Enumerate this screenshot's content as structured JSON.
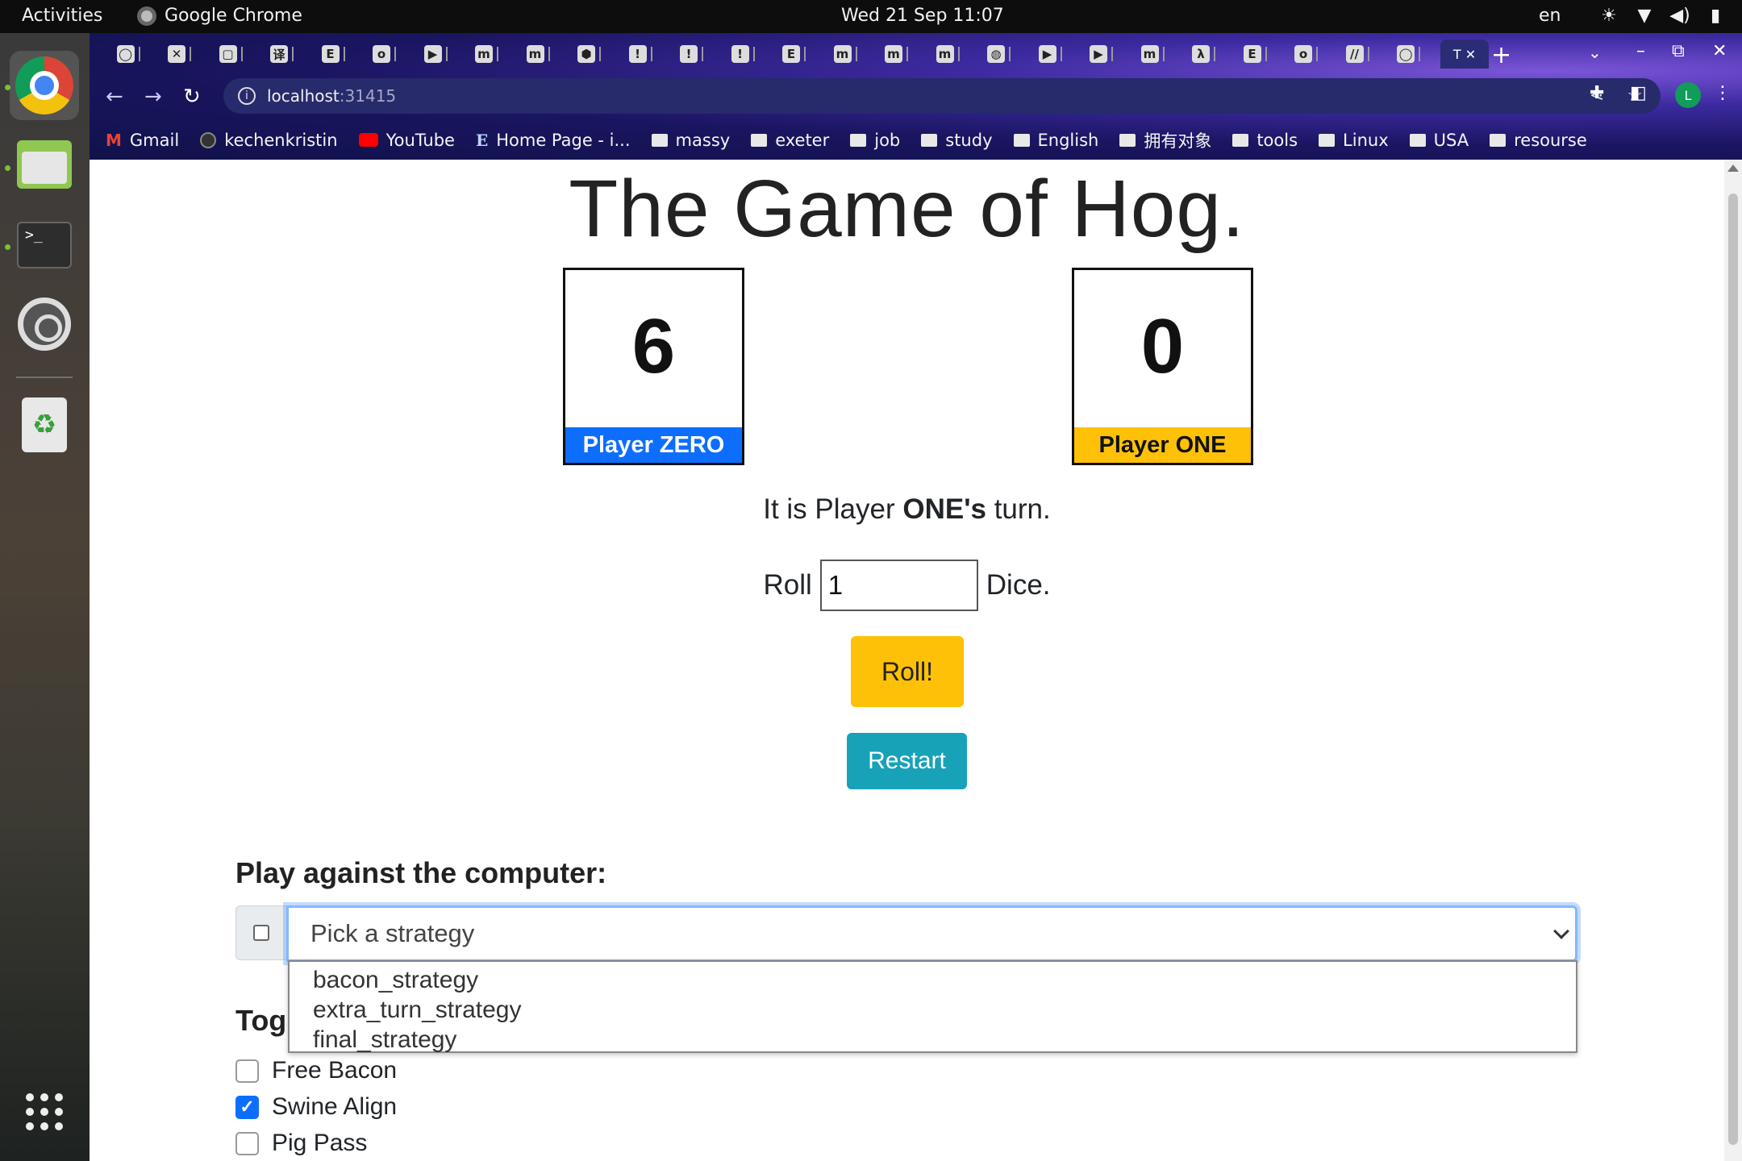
{
  "os": {
    "activities": "Activities",
    "app_name": "Google Chrome",
    "clock": "Wed 21 Sep  11:07",
    "language": "en"
  },
  "browser": {
    "tabs": [
      {
        "icon": "github-icon",
        "glyph": "◯"
      },
      {
        "icon": "exeter-icon",
        "glyph": "✕"
      },
      {
        "icon": "blank-icon",
        "glyph": "▢"
      },
      {
        "icon": "translate-icon",
        "glyph": "译"
      },
      {
        "icon": "e-icon",
        "glyph": "E"
      },
      {
        "icon": "outlook-icon",
        "glyph": "o"
      },
      {
        "icon": "play-icon",
        "glyph": "▶"
      },
      {
        "icon": "m-icon",
        "glyph": "m"
      },
      {
        "icon": "m-icon",
        "glyph": "m"
      },
      {
        "icon": "cube-icon",
        "glyph": "⬢"
      },
      {
        "icon": "red-icon",
        "glyph": "!"
      },
      {
        "icon": "red-icon",
        "glyph": "!"
      },
      {
        "icon": "red-icon",
        "glyph": "!"
      },
      {
        "icon": "e-icon",
        "glyph": "E"
      },
      {
        "icon": "m-icon",
        "glyph": "m"
      },
      {
        "icon": "m-icon",
        "glyph": "m"
      },
      {
        "icon": "m-icon",
        "glyph": "m"
      },
      {
        "icon": "globe-icon",
        "glyph": "◍"
      },
      {
        "icon": "play-icon",
        "glyph": "▶"
      },
      {
        "icon": "play-icon",
        "glyph": "▶"
      },
      {
        "icon": "m-icon",
        "glyph": "m"
      },
      {
        "icon": "lambda-icon",
        "glyph": "λ"
      },
      {
        "icon": "e-icon",
        "glyph": "E"
      },
      {
        "icon": "outlook-icon",
        "glyph": "o"
      },
      {
        "icon": "slash-icon",
        "glyph": "//"
      },
      {
        "icon": "github-icon",
        "glyph": "◯"
      }
    ],
    "active_tab_label": "T",
    "url_host": "localhost",
    "url_port": ":31415",
    "profile_initial": "L",
    "bookmarks": [
      {
        "label": "Gmail",
        "icon": "gmail"
      },
      {
        "label": "kechenkristin",
        "icon": "gh"
      },
      {
        "label": "YouTube",
        "icon": "yt"
      },
      {
        "label": "Home Page - i...",
        "icon": "e"
      },
      {
        "label": "massy",
        "icon": "folder"
      },
      {
        "label": "exeter",
        "icon": "folder"
      },
      {
        "label": "job",
        "icon": "folder"
      },
      {
        "label": "study",
        "icon": "folder"
      },
      {
        "label": "English",
        "icon": "folder"
      },
      {
        "label": "拥有对象",
        "icon": "folder"
      },
      {
        "label": "tools",
        "icon": "folder"
      },
      {
        "label": "Linux",
        "icon": "folder"
      },
      {
        "label": "USA",
        "icon": "folder"
      },
      {
        "label": "resourse",
        "icon": "folder"
      }
    ]
  },
  "game": {
    "title_light": "The Game of ",
    "title_bold": "Hog.",
    "player_zero": {
      "score": "6",
      "label": "Player ZERO",
      "color": "#0d6efd"
    },
    "player_one": {
      "score": "0",
      "label": "Player ONE",
      "color": "#ffc107"
    },
    "turn_prefix": "It is Player ",
    "turn_player": "ONE's",
    "turn_suffix": " turn.",
    "roll_label": "Roll",
    "roll_value": "1",
    "dice_label": "Dice.",
    "roll_button": "Roll!",
    "restart_button": "Restart",
    "play_heading": "Play against the computer:",
    "strategy_placeholder": "Pick a strategy",
    "strategy_options": [
      "bacon_strategy",
      "extra_turn_strategy",
      "final_strategy"
    ],
    "toggle_heading": "Tog",
    "toggles": [
      {
        "label": "Free Bacon",
        "checked": false
      },
      {
        "label": "Swine Align",
        "checked": true
      },
      {
        "label": "Pig Pass",
        "checked": false
      }
    ]
  }
}
